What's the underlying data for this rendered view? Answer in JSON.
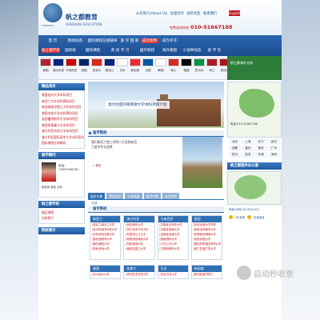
{
  "header": {
    "logo_text": "帆之都教育",
    "logo_en": "FANZHIDU EDUCATION",
    "logo_sub": "FANZHIDU",
    "top_links": [
      "公司简介|About Us|",
      "加盟合作",
      "国外招生",
      "联系我们"
    ],
    "english_button": "English",
    "phone_label": "免费咨询热线",
    "phone": "010-51667188"
  },
  "nav": {
    "row1": [
      "首 页",
      "新闻动态",
      "国际课程在线辅导",
      "留 学 国 家",
      "成功案例",
      "成为学子"
    ],
    "row2": [
      "国际班",
      "国际课程",
      "英 语 学 习",
      "國外院校",
      "海外教授",
      "小语种动态",
      "留 学 生"
    ],
    "highlight_label": "帆之都学校"
  },
  "flags": {
    "items": [
      {
        "label": "美国",
        "color": "#b22234"
      },
      {
        "label": "澳大利亚",
        "color": "#00247d"
      },
      {
        "label": "马来西亚",
        "color": "#cc0001"
      },
      {
        "label": "英国",
        "color": "#012169"
      },
      {
        "label": "加拿大",
        "color": "#d52b1e"
      },
      {
        "label": "新西兰",
        "color": "#00247d"
      },
      {
        "label": "日本",
        "color": "#ffffff"
      },
      {
        "label": "新加坡",
        "color": "#ed2939"
      },
      {
        "label": "法国",
        "color": "#0055a4"
      },
      {
        "label": "韩国",
        "color": "#ffffff"
      },
      {
        "label": "瑞士",
        "color": "#d52b1e"
      },
      {
        "label": "德国",
        "color": "#000000"
      },
      {
        "label": "意大利",
        "color": "#009246"
      },
      {
        "label": "荷兰",
        "color": "#ae1c28"
      },
      {
        "label": "西班牙",
        "color": "#aa151b"
      },
      {
        "label": "俄罗斯",
        "color": "#0039a6"
      }
    ],
    "side_label": "帆之都海外分校"
  },
  "left": {
    "projects_title": "精品项目",
    "projects": [
      "美国加州大学本科项目",
      "新西兰大学本科预科项目",
      "新加坡南洋理工大学本科项目",
      "美国名校大学本科预科项目",
      "英国曼彻斯特大学本科项目",
      "美国常青藤大学本科项目",
      "澳大利亚名校大学本科项目",
      "澳大利亚国际高中大学本科直升项目",
      "国际课程在线辅导"
    ],
    "advisor_title": "留学顾问",
    "advisor_tel": "电话：13651566761",
    "advisor_names": "杨老师  吴老 大利",
    "school_title": "帆之都学校",
    "school_links": [
      "精品课程",
      "学校简介"
    ],
    "grad_title": "院校展示"
  },
  "middle": {
    "banner_text": "澳大利亚阿德莱德大学本科项目介绍",
    "intro_title": "留学院校",
    "intro_text": "我们新西兰理工学院六大优势新西兰留学专业选择",
    "intro_more": "» 更多",
    "tabs": [
      "留学文章",
      "签证资讯",
      "行前准备",
      "留学专题",
      "成功案例"
    ],
    "tab_body": "访谈",
    "schools_title": "留学院校",
    "cards_r1": [
      {
        "title": "新西兰",
        "lines": [
          "[奥克兰]奥克兰大学",
          "[惠灵顿]维多利亚大学",
          "[坎特]坎特伯雷大学",
          "[奥塔]奥塔哥大学",
          "[梅西]梅西大学",
          "[林肯]林肯大学"
        ]
      },
      {
        "title": "澳大利亚",
        "lines": [
          "[悉尼]悉尼大学",
          "[墨尔本]墨尔本大学",
          "[布里]昆士兰大学",
          "[阿德]阿德莱德大学",
          "[珀斯]西澳大学",
          "[堪培拉]国立大学"
        ]
      },
      {
        "title": "马来西亚",
        "lines": [
          "[吉隆坡]马来亚大学",
          "[吉隆坡]泰莱大学",
          "[吉隆坡]双威大学",
          "[槟城]理科大学",
          "[沙巴]沙巴大学",
          "[古晋]斯威本大学"
        ]
      },
      {
        "title": "英国",
        "lines": [
          "[伦敦]伦敦大学学院",
          "[曼城]曼彻斯特大学",
          "[伯明翰]伯明翰大学",
          "[利兹]利兹大学",
          "[格拉斯哥]格拉斯哥大学",
          "[爱丁堡]爱丁堡大学"
        ]
      }
    ],
    "cards_r2": [
      {
        "title": "美国",
        "lines": [
          "[加州]加州大学"
        ]
      },
      {
        "title": "加拿大",
        "lines": [
          "[多伦多]多伦多大学"
        ]
      },
      {
        "title": "日本",
        "lines": [
          "[东京]东京大学"
        ]
      },
      {
        "title": "新加坡",
        "lines": [
          "[新加坡]南洋理工"
        ]
      }
    ]
  },
  "right": {
    "map_title": "帆之都海外分校",
    "map_contact": "电话:010-51667188",
    "cities": [
      "北京",
      "上海",
      "长沙",
      "武汉",
      "成都",
      "重庆",
      "南京",
      "广州",
      "杭州",
      "西安",
      "天津",
      "深圳"
    ],
    "small_map_title": "帆之都国外办公室",
    "small_map_text": "电话:0086-01-8242221",
    "qq_items": [
      "QQ咨询",
      "在线留言"
    ]
  },
  "watermark": {
    "text": "自动秒收录"
  }
}
